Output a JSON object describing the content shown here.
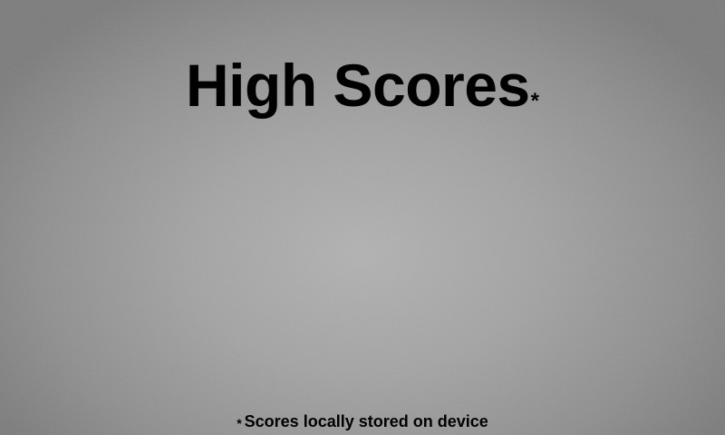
{
  "screen": {
    "title": "High Scores",
    "title_marker": "*",
    "footnote_marker": "*",
    "footnote": "Scores locally stored on device",
    "scores": []
  },
  "colors": {
    "text": "#000000",
    "background_center": "#b2b2b2",
    "background_edge": "#7a7a7a"
  }
}
